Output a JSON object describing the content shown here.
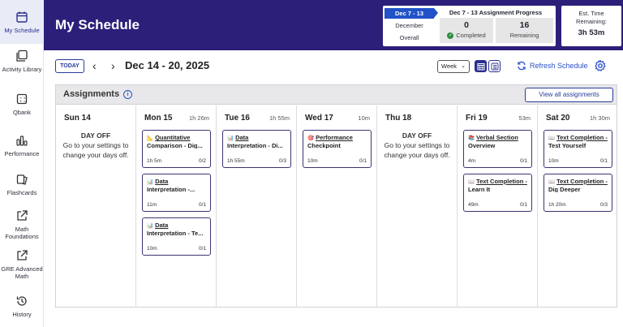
{
  "sidebar": {
    "items": [
      {
        "label": "My Schedule",
        "icon": "calendar-icon",
        "active": true
      },
      {
        "label": "Activity Library",
        "icon": "library-icon"
      },
      {
        "label": "Qbank",
        "icon": "qbank-icon"
      },
      {
        "label": "Performance",
        "icon": "bar-chart-icon"
      },
      {
        "label": "Flashcards",
        "icon": "flashcards-icon"
      },
      {
        "label": "Math Foundations",
        "icon": "external-link-icon"
      },
      {
        "label": "GRE Advanced Math",
        "icon": "external-link-icon"
      },
      {
        "label": "History",
        "icon": "history-icon"
      }
    ]
  },
  "header": {
    "title": "My Schedule",
    "progress": {
      "week_badge": "Dec 7 - 13",
      "month": "December",
      "overall": "Overall",
      "title": "Dec 7 - 13 Assignment Progress",
      "completed_value": "0",
      "completed_label": "Completed",
      "remaining_value": "16",
      "remaining_label": "Remaining"
    },
    "estimate": {
      "label_line1": "Est. Time",
      "label_line2": "Remaining:",
      "value": "3h 53m"
    }
  },
  "toolbar": {
    "today": "TODAY",
    "prev": "‹",
    "next": "›",
    "date_range": "Dec 14 - 20, 2025",
    "view_select": "Week",
    "refresh": "Refresh Schedule"
  },
  "assignments": {
    "title": "Assignments",
    "view_all": "View all assignments",
    "days": [
      {
        "name": "Sun 14",
        "time": "",
        "off": true,
        "off_title": "DAY OFF",
        "off_text": "Go to your settings to change your days off.",
        "cards": []
      },
      {
        "name": "Mon 15",
        "time": "1h 26m",
        "off": false,
        "cards": [
          {
            "title": "Quantitative Comparison - Dig...",
            "duration": "1h 5m",
            "count": "0/2"
          },
          {
            "title": "Data Interpretation -...",
            "duration": "11m",
            "count": "0/1"
          },
          {
            "title": "Data Interpretation - Te...",
            "duration": "10m",
            "count": "0/1"
          }
        ]
      },
      {
        "name": "Tue 16",
        "time": "1h 55m",
        "off": false,
        "cards": [
          {
            "title": "Data Interpretation - Di...",
            "duration": "1h 55m",
            "count": "0/3"
          }
        ]
      },
      {
        "name": "Wed 17",
        "time": "10m",
        "off": false,
        "cards": [
          {
            "title": "Performance Checkpoint",
            "duration": "10m",
            "count": "0/1"
          }
        ]
      },
      {
        "name": "Thu 18",
        "time": "",
        "off": true,
        "off_title": "DAY OFF",
        "off_text": "Go to your settings to change your days off.",
        "cards": []
      },
      {
        "name": "Fri 19",
        "time": "53m",
        "off": false,
        "cards": [
          {
            "title": "Verbal Section Overview",
            "duration": "4m",
            "count": "0/1"
          },
          {
            "title": "Text Completion - Learn It",
            "duration": "49m",
            "count": "0/1"
          }
        ]
      },
      {
        "name": "Sat 20",
        "time": "1h 30m",
        "off": false,
        "cards": [
          {
            "title": "Text Completion - Test Yourself",
            "duration": "10m",
            "count": "0/1"
          },
          {
            "title": "Text Completion - Dig Deeper",
            "duration": "1h 20m",
            "count": "0/3"
          }
        ]
      }
    ]
  },
  "colors": {
    "header_bg": "#2b1f7a",
    "accent": "#2a52c8",
    "week_badge": "#2152c8",
    "completed_green": "#2e8b3e"
  }
}
